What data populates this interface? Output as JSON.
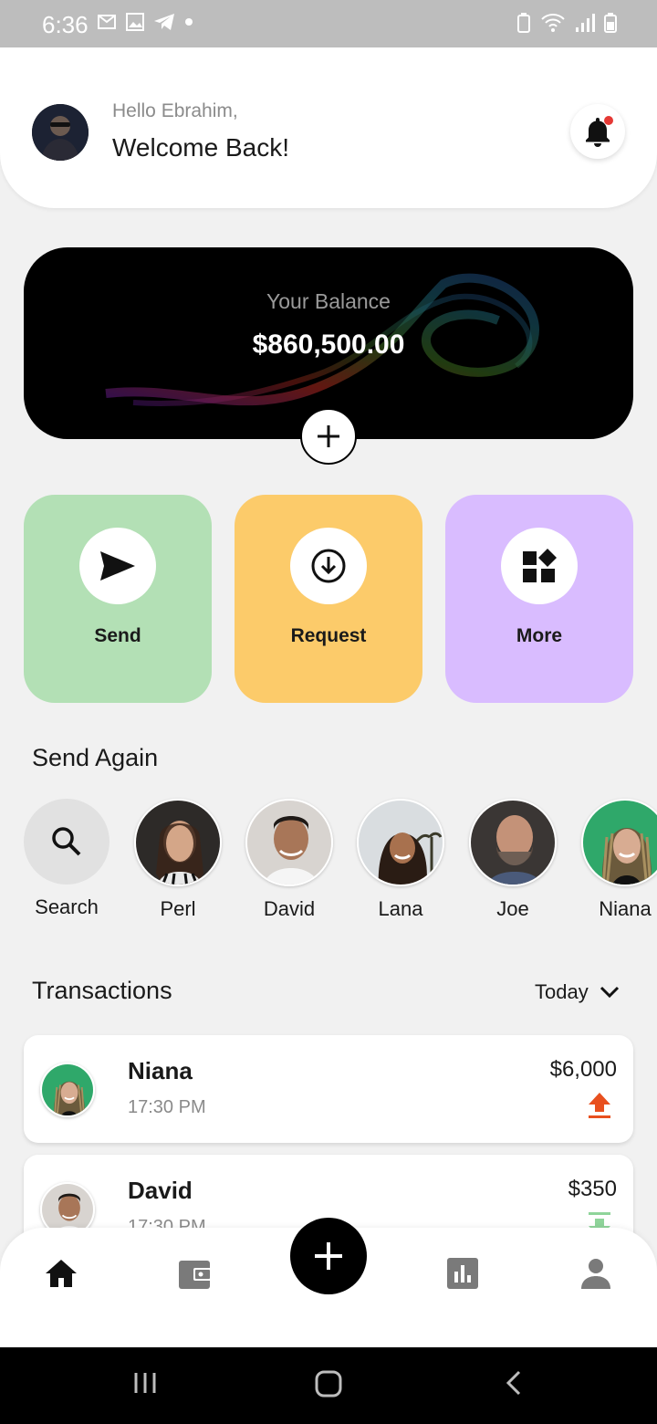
{
  "status_bar": {
    "time": "6:36"
  },
  "header": {
    "greeting": "Hello Ebrahim,",
    "title": "Welcome Back!"
  },
  "balance": {
    "label": "Your Balance",
    "amount": "$860,500.00"
  },
  "actions": [
    {
      "label": "Send",
      "color": "#b3e0b5"
    },
    {
      "label": "Request",
      "color": "#fccb6a"
    },
    {
      "label": "More",
      "color": "#d9bcff"
    }
  ],
  "send_again": {
    "title": "Send Again",
    "search_label": "Search",
    "contacts": [
      {
        "name": "Perl"
      },
      {
        "name": "David"
      },
      {
        "name": "Lana"
      },
      {
        "name": "Joe"
      },
      {
        "name": "Niana"
      }
    ]
  },
  "transactions": {
    "title": "Transactions",
    "filter": "Today",
    "items": [
      {
        "name": "Niana",
        "time": "17:30 PM",
        "amount": "$6,000",
        "direction": "outgoing"
      },
      {
        "name": "David",
        "time": "17:30 PM",
        "amount": "$350",
        "direction": "incoming"
      }
    ]
  },
  "colors": {
    "outgoing": "#e8501f",
    "incoming": "#8fd49a"
  },
  "nav": {
    "items": [
      "home-icon",
      "wallet-icon",
      "add-icon",
      "chart-icon",
      "profile-icon"
    ]
  }
}
